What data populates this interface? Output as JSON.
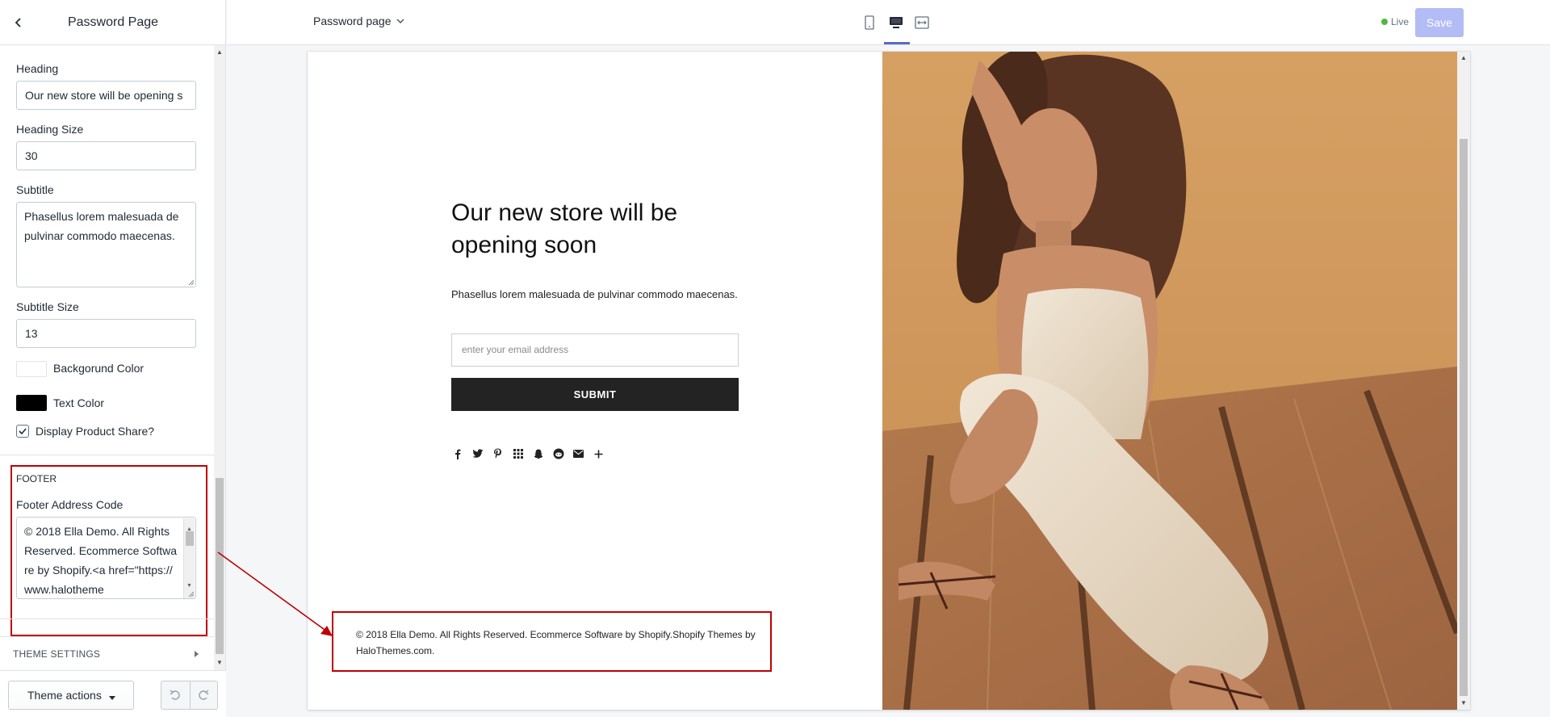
{
  "sidebar": {
    "title": "Password Page",
    "fields": {
      "heading_label": "Heading",
      "heading_value": "Our new store will be  opening s",
      "heading_size_label": "Heading Size",
      "heading_size_value": "30",
      "subtitle_label": "Subtitle",
      "subtitle_value": "Phasellus lorem malesuada de pulvinar commodo maecenas.",
      "subtitle_size_label": "Subtitle Size",
      "subtitle_size_value": "13",
      "background_color_label": "Backgorund Color",
      "background_color": "#ffffff",
      "text_color_label": "Text Color",
      "text_color": "#000000",
      "display_share_label": "Display Product Share?",
      "display_share_checked": true
    },
    "footer_section": {
      "title": "FOOTER",
      "address_label": "Footer Address Code",
      "address_value": "© 2018 Ella Demo. All Rights Reserved. Ecommerce Software by Shopify.<a href=\"https://www.halotheme"
    },
    "theme_settings_label": "THEME SETTINGS",
    "theme_actions_label": "Theme actions"
  },
  "topbar": {
    "page_selector": "Password page",
    "live_label": "Live",
    "save_label": "Save",
    "accent_color": "#5c6ac4",
    "live_color": "#50b83c"
  },
  "preview": {
    "heading": "Our new store will be opening soon",
    "subtitle": "Phasellus lorem malesuada de pulvinar commodo maecenas.",
    "email_placeholder": "enter your email address",
    "submit_label": "SUBMIT",
    "social_icons": [
      "facebook-icon",
      "twitter-icon",
      "pinterest-icon",
      "grid-icon",
      "snapchat-icon",
      "reddit-icon",
      "email-icon",
      "plus-icon"
    ],
    "footer_text": "© 2018 Ella Demo. All Rights Reserved. Ecommerce Software by Shopify.Shopify Themes by HaloThemes.com."
  },
  "annotation_color": "#c00000"
}
